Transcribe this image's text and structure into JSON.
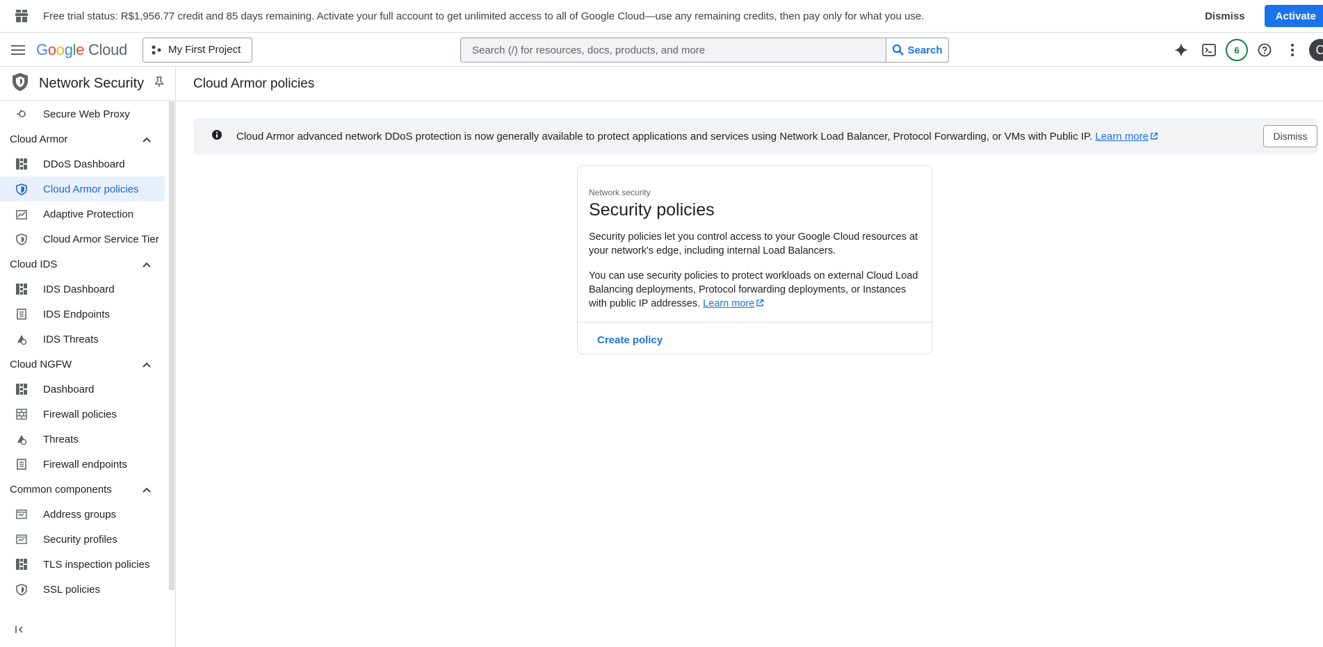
{
  "trial_banner": {
    "message": "Free trial status: R$1,956.77 credit and 85 days remaining. Activate your full account to get unlimited access to all of Google Cloud—use any remaining credits, then pay only for what you use.",
    "dismiss_label": "Dismiss",
    "activate_label": "Activate"
  },
  "header": {
    "logo_google": "Google",
    "logo_cloud": "Cloud",
    "project_label": "My First Project",
    "search_placeholder": "Search (/) for resources, docs, products, and more",
    "search_button": "Search",
    "notification_count": "6",
    "avatar_letter": "C"
  },
  "sidebar": {
    "title": "Network Security",
    "items": [
      {
        "type": "item",
        "label": "Secure Web Proxy",
        "icon": "proxy-icon"
      },
      {
        "type": "section",
        "label": "Cloud Armor"
      },
      {
        "type": "item",
        "label": "DDoS Dashboard",
        "icon": "dashboard-icon"
      },
      {
        "type": "item",
        "label": "Cloud Armor policies",
        "icon": "shield-icon",
        "active": true
      },
      {
        "type": "item",
        "label": "Adaptive Protection",
        "icon": "chart-icon"
      },
      {
        "type": "item",
        "label": "Cloud Armor Service Tier",
        "icon": "shield-icon"
      },
      {
        "type": "section",
        "label": "Cloud IDS"
      },
      {
        "type": "item",
        "label": "IDS Dashboard",
        "icon": "dashboard-icon"
      },
      {
        "type": "item",
        "label": "IDS Endpoints",
        "icon": "endpoint-icon"
      },
      {
        "type": "item",
        "label": "IDS Threats",
        "icon": "threat-icon"
      },
      {
        "type": "section",
        "label": "Cloud NGFW"
      },
      {
        "type": "item",
        "label": "Dashboard",
        "icon": "dashboard-icon"
      },
      {
        "type": "item",
        "label": "Firewall policies",
        "icon": "firewall-icon"
      },
      {
        "type": "item",
        "label": "Threats",
        "icon": "threat-icon"
      },
      {
        "type": "item",
        "label": "Firewall endpoints",
        "icon": "endpoint-icon"
      },
      {
        "type": "section",
        "label": "Common components"
      },
      {
        "type": "item",
        "label": "Address groups",
        "icon": "group-icon"
      },
      {
        "type": "item",
        "label": "Security profiles",
        "icon": "group-icon"
      },
      {
        "type": "item",
        "label": "TLS inspection policies",
        "icon": "dashboard-icon"
      },
      {
        "type": "item",
        "label": "SSL policies",
        "icon": "shield-icon"
      }
    ]
  },
  "main": {
    "page_title": "Cloud Armor policies",
    "info_banner": {
      "text": "Cloud Armor advanced network DDoS protection is now generally available to protect applications and services using Network Load Balancer, Protocol Forwarding, or VMs with Public IP.",
      "link": "Learn more",
      "dismiss_label": "Dismiss"
    },
    "card": {
      "eyebrow": "Network security",
      "title": "Security policies",
      "paragraph1": "Security policies let you control access to your Google Cloud resources at your network's edge, including internal Load Balancers.",
      "paragraph2": "You can use security policies to protect workloads on external Cloud Load Balancing deployments, Protocol forwarding deployments, or Instances with public IP addresses.",
      "link": "Learn more",
      "create_label": "Create policy"
    }
  }
}
